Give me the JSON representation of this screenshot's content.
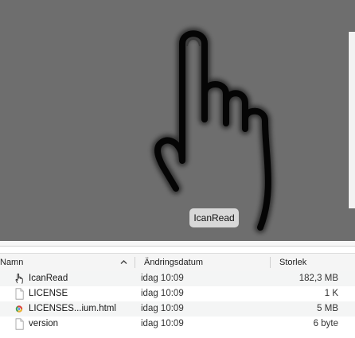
{
  "preview": {
    "app_name": "IcanRead",
    "icon": "pointing-hand-icon",
    "background_color": "#6e6e6e"
  },
  "columns": {
    "name": "Namn",
    "modified": "Ändringsdatum",
    "size": "Storlek",
    "sort_icon": "sort-ascending-icon"
  },
  "files": [
    {
      "name": "IcanRead",
      "modified": "idag 10:09",
      "size": "182,3 MB",
      "icon": "hand-cursor-icon"
    },
    {
      "name": "LICENSE",
      "modified": "idag 10:09",
      "size": "1 K",
      "icon": "document-icon"
    },
    {
      "name": "LICENSES...ium.html",
      "modified": "idag 10:09",
      "size": "5 MB",
      "icon": "html-file-icon"
    },
    {
      "name": "version",
      "modified": "idag 10:09",
      "size": "6 byte",
      "icon": "document-icon"
    }
  ]
}
